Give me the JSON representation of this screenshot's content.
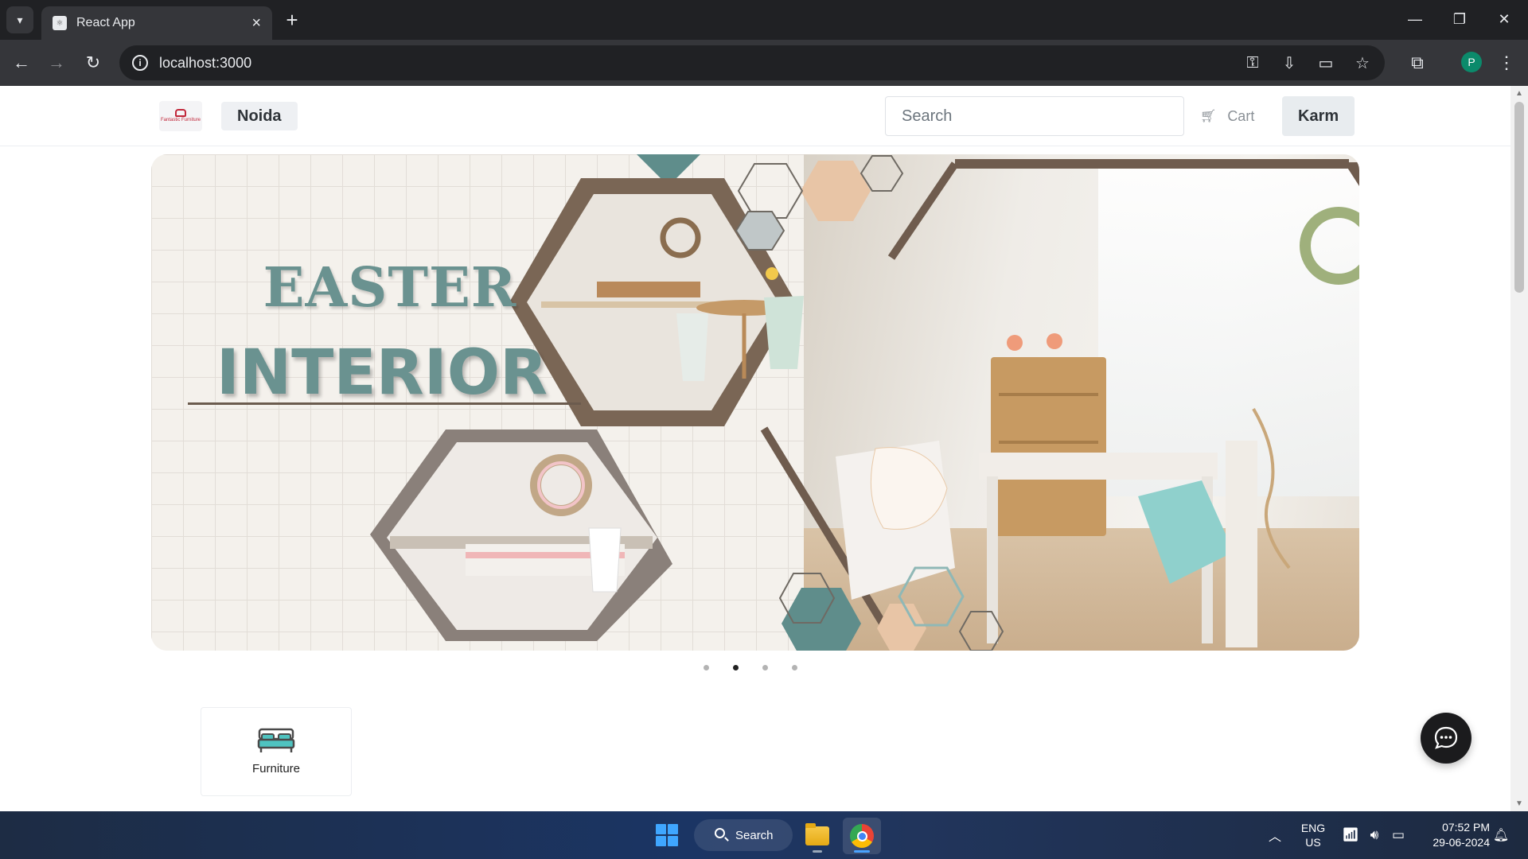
{
  "browser": {
    "tab_title": "React App",
    "url": "localhost:3000",
    "profile_initial": "P"
  },
  "site": {
    "logo_text": "Fantastic Furniture",
    "location": "Noida",
    "search_placeholder": "Search",
    "cart_label": "Cart",
    "user_name": "Karm"
  },
  "banner": {
    "title_line1": "EASTER",
    "title_line2": "INTERIOR",
    "slide_count": 4,
    "active_slide": 2,
    "accent_color": "#6a9290"
  },
  "categories": [
    {
      "label": "Furniture",
      "icon": "bed-icon"
    }
  ],
  "taskbar": {
    "search_label": "Search",
    "lang_line1": "ENG",
    "lang_line2": "US",
    "time": "07:52 PM",
    "date": "29-06-2024"
  }
}
